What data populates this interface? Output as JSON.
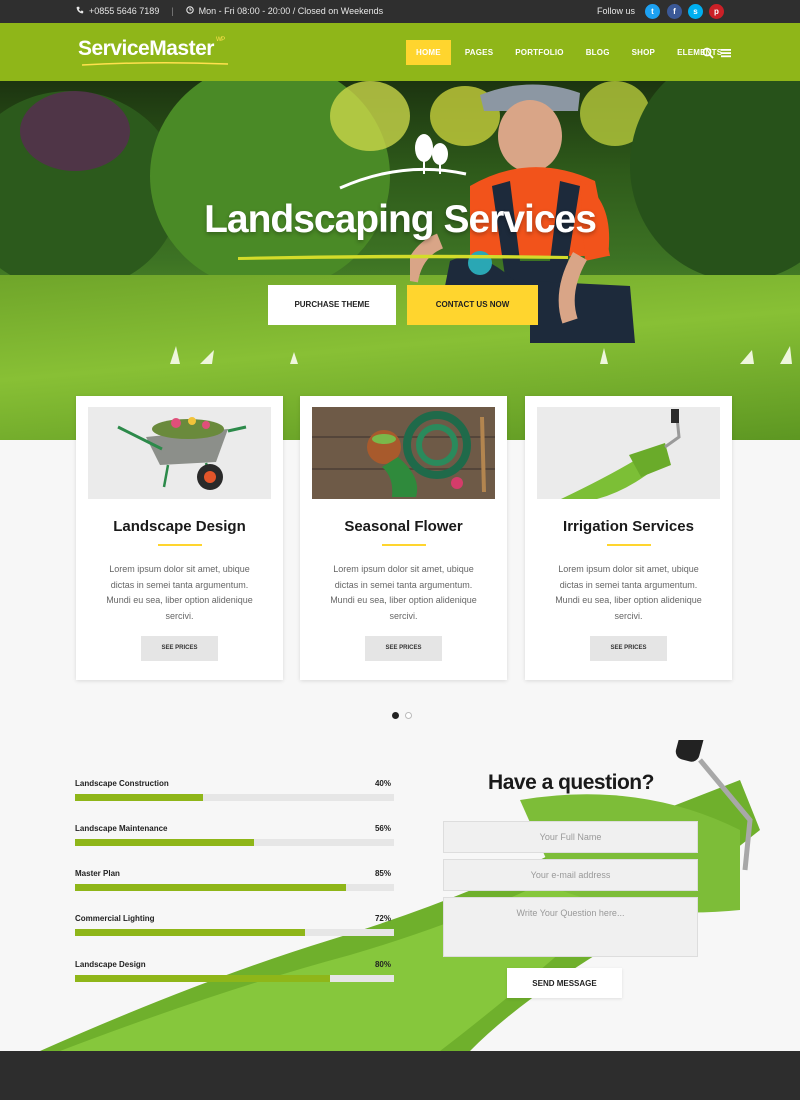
{
  "topbar": {
    "phone": "+0855 5646 7189",
    "hours": "Mon - Fri 08:00 - 20:00 / Closed on Weekends",
    "follow_label": "Follow us",
    "social": [
      {
        "icon": "twitter-icon",
        "glyph": "t",
        "color": "#1da1f2"
      },
      {
        "icon": "facebook-icon",
        "glyph": "f",
        "color": "#3b5998"
      },
      {
        "icon": "skype-icon",
        "glyph": "s",
        "color": "#00aff0"
      },
      {
        "icon": "pinterest-icon",
        "glyph": "p",
        "color": "#cb2027"
      }
    ]
  },
  "nav": {
    "logo": "ServiceMaster",
    "logo_badge": "WP",
    "items": [
      {
        "label": "HOME",
        "active": true
      },
      {
        "label": "PAGES",
        "active": false
      },
      {
        "label": "PORTFOLIO",
        "active": false
      },
      {
        "label": "BLOG",
        "active": false
      },
      {
        "label": "SHOP",
        "active": false
      },
      {
        "label": "ELEMENTS",
        "active": false
      }
    ],
    "icons": [
      "search-icon",
      "menu-icon"
    ]
  },
  "hero": {
    "title": "Landscaping Services",
    "buttons": {
      "primary": "PURCHASE THEME",
      "secondary": "CONTACT US NOW"
    }
  },
  "services": [
    {
      "title": "Landscape Design",
      "text": "Lorem ipsum dolor sit amet, ubique dictas in semei tanta argumentum. Mundi eu sea, liber option alidenique sercivi.",
      "button": "SEE PRICES",
      "image": "wheelbarrow-image"
    },
    {
      "title": "Seasonal Flower",
      "text": "Lorem ipsum dolor sit amet, ubique dictas in semei tanta argumentum. Mundi eu sea, liber option alidenique sercivi.",
      "button": "SEE PRICES",
      "image": "garden-hose-image"
    },
    {
      "title": "Irrigation Services",
      "text": "Lorem ipsum dolor sit amet, ubique dictas in semei tanta argumentum. Mundi eu sea, liber option alidenique sercivi.",
      "button": "SEE PRICES",
      "image": "grass-roller-image"
    }
  ],
  "carousel": {
    "pages": 2,
    "active": 0
  },
  "skills": [
    {
      "label": "Landscape Construction",
      "pct_text": "40%",
      "value": 40
    },
    {
      "label": "Landscape Maintenance",
      "pct_text": "56%",
      "value": 56
    },
    {
      "label": "Master Plan",
      "pct_text": "85%",
      "value": 85
    },
    {
      "label": "Commercial Lighting",
      "pct_text": "72%",
      "value": 72
    },
    {
      "label": "Landscape Design",
      "pct_text": "80%",
      "value": 80
    }
  ],
  "form": {
    "title": "Have a question?",
    "name_placeholder": "Your Full Name",
    "email_placeholder": "Your e-mail address",
    "question_placeholder": "Write Your Question here...",
    "submit": "SEND MESSAGE"
  },
  "colors": {
    "accent_green": "#8fb619",
    "accent_yellow": "#ffd52e",
    "topbar": "#2f2f2f"
  }
}
